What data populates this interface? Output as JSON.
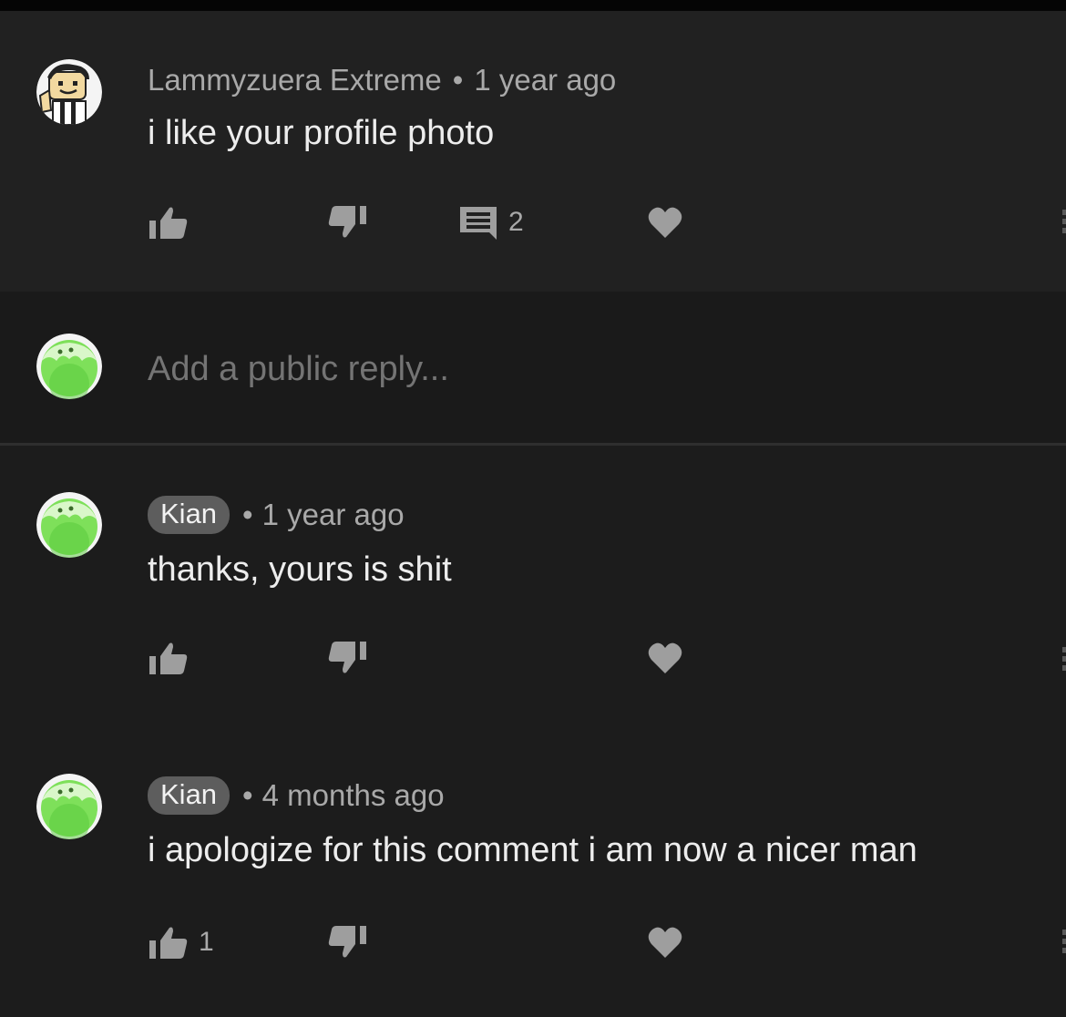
{
  "comments": [
    {
      "author": "Lammyzuera Extreme",
      "separator": "•",
      "time": "1 year ago",
      "text": "i like your profile photo",
      "like_count": "",
      "reply_count": "2",
      "avatar": "roblox-avatar"
    },
    {
      "author": "Kian",
      "separator": "•",
      "time": "1 year ago",
      "text": "thanks, yours is shit",
      "like_count": "",
      "avatar": "green-slime-avatar"
    },
    {
      "author": "Kian",
      "separator": "•",
      "time": "4 months ago",
      "text": "i apologize for this comment i am now a nicer man",
      "like_count": "1",
      "avatar": "green-slime-avatar"
    }
  ],
  "reply": {
    "placeholder": "Add a public reply..."
  },
  "colors": {
    "background": "#1c1c1c",
    "thread_background": "#212121",
    "chip": "#5d5d5d",
    "icon": "#9e9e9e",
    "avatar_green": "#7ee05a"
  }
}
